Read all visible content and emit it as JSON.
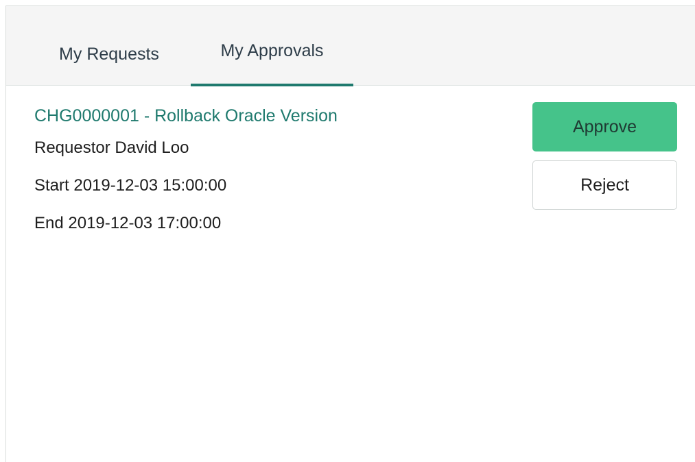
{
  "tabs": [
    {
      "label": "My Requests",
      "active": false
    },
    {
      "label": "My Approvals",
      "active": true
    }
  ],
  "approval": {
    "title": "CHG0000001 - Rollback Oracle Version",
    "requestor": "Requestor David Loo",
    "start": "Start 2019-12-03 15:00:00",
    "end": "End 2019-12-03 17:00:00"
  },
  "actions": {
    "approve_label": "Approve",
    "reject_label": "Reject"
  },
  "colors": {
    "accent": "#1f7a6e",
    "approve_bg": "#45c38a",
    "tab_bar_bg": "#f5f5f5"
  }
}
